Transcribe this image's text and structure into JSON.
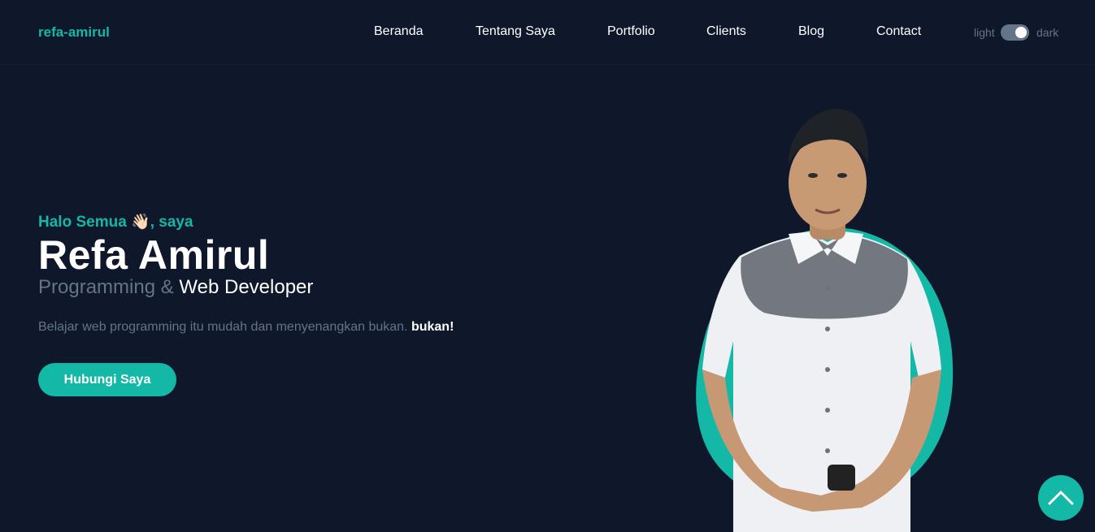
{
  "brand": "refa-amirul",
  "nav": {
    "items": [
      {
        "label": "Beranda",
        "name": "nav-beranda"
      },
      {
        "label": "Tentang Saya",
        "name": "nav-tentang-saya"
      },
      {
        "label": "Portfolio",
        "name": "nav-portfolio"
      },
      {
        "label": "Clients",
        "name": "nav-clients"
      },
      {
        "label": "Blog",
        "name": "nav-blog"
      },
      {
        "label": "Contact",
        "name": "nav-contact"
      }
    ]
  },
  "theme": {
    "light_label": "light",
    "dark_label": "dark",
    "mode": "dark"
  },
  "hero": {
    "greeting_prefix": "Halo Semua",
    "greeting_emoji": "👋🏻",
    "greeting_suffix": ", saya",
    "name": "Refa Amirul",
    "role_part1": "Programming &",
    "role_part2": "Web Developer",
    "description": "Belajar web programming itu mudah dan menyenangkan bukan.",
    "description_bold": "bukan!",
    "cta_label": "Hubungi Saya",
    "photo_icon": "person-portrait-icon"
  },
  "scroll_top_icon": "chevron-up-icon",
  "colors": {
    "accent": "#14b8a6",
    "background": "#0f172a",
    "muted": "#64748b",
    "text": "#ffffff"
  }
}
